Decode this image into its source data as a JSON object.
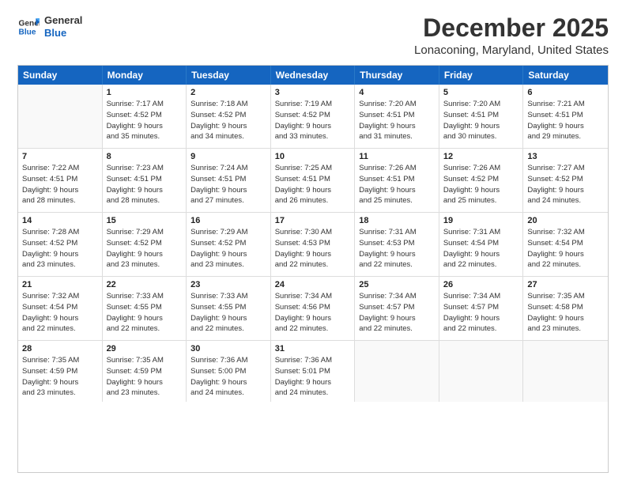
{
  "header": {
    "logo_line1": "General",
    "logo_line2": "Blue",
    "main_title": "December 2025",
    "subtitle": "Lonaconing, Maryland, United States"
  },
  "calendar": {
    "days_of_week": [
      "Sunday",
      "Monday",
      "Tuesday",
      "Wednesday",
      "Thursday",
      "Friday",
      "Saturday"
    ],
    "rows": [
      [
        {
          "day": "",
          "info": ""
        },
        {
          "day": "1",
          "info": "Sunrise: 7:17 AM\nSunset: 4:52 PM\nDaylight: 9 hours\nand 35 minutes."
        },
        {
          "day": "2",
          "info": "Sunrise: 7:18 AM\nSunset: 4:52 PM\nDaylight: 9 hours\nand 34 minutes."
        },
        {
          "day": "3",
          "info": "Sunrise: 7:19 AM\nSunset: 4:52 PM\nDaylight: 9 hours\nand 33 minutes."
        },
        {
          "day": "4",
          "info": "Sunrise: 7:20 AM\nSunset: 4:51 PM\nDaylight: 9 hours\nand 31 minutes."
        },
        {
          "day": "5",
          "info": "Sunrise: 7:20 AM\nSunset: 4:51 PM\nDaylight: 9 hours\nand 30 minutes."
        },
        {
          "day": "6",
          "info": "Sunrise: 7:21 AM\nSunset: 4:51 PM\nDaylight: 9 hours\nand 29 minutes."
        }
      ],
      [
        {
          "day": "7",
          "info": "Sunrise: 7:22 AM\nSunset: 4:51 PM\nDaylight: 9 hours\nand 28 minutes."
        },
        {
          "day": "8",
          "info": "Sunrise: 7:23 AM\nSunset: 4:51 PM\nDaylight: 9 hours\nand 28 minutes."
        },
        {
          "day": "9",
          "info": "Sunrise: 7:24 AM\nSunset: 4:51 PM\nDaylight: 9 hours\nand 27 minutes."
        },
        {
          "day": "10",
          "info": "Sunrise: 7:25 AM\nSunset: 4:51 PM\nDaylight: 9 hours\nand 26 minutes."
        },
        {
          "day": "11",
          "info": "Sunrise: 7:26 AM\nSunset: 4:51 PM\nDaylight: 9 hours\nand 25 minutes."
        },
        {
          "day": "12",
          "info": "Sunrise: 7:26 AM\nSunset: 4:52 PM\nDaylight: 9 hours\nand 25 minutes."
        },
        {
          "day": "13",
          "info": "Sunrise: 7:27 AM\nSunset: 4:52 PM\nDaylight: 9 hours\nand 24 minutes."
        }
      ],
      [
        {
          "day": "14",
          "info": "Sunrise: 7:28 AM\nSunset: 4:52 PM\nDaylight: 9 hours\nand 23 minutes."
        },
        {
          "day": "15",
          "info": "Sunrise: 7:29 AM\nSunset: 4:52 PM\nDaylight: 9 hours\nand 23 minutes."
        },
        {
          "day": "16",
          "info": "Sunrise: 7:29 AM\nSunset: 4:52 PM\nDaylight: 9 hours\nand 23 minutes."
        },
        {
          "day": "17",
          "info": "Sunrise: 7:30 AM\nSunset: 4:53 PM\nDaylight: 9 hours\nand 22 minutes."
        },
        {
          "day": "18",
          "info": "Sunrise: 7:31 AM\nSunset: 4:53 PM\nDaylight: 9 hours\nand 22 minutes."
        },
        {
          "day": "19",
          "info": "Sunrise: 7:31 AM\nSunset: 4:54 PM\nDaylight: 9 hours\nand 22 minutes."
        },
        {
          "day": "20",
          "info": "Sunrise: 7:32 AM\nSunset: 4:54 PM\nDaylight: 9 hours\nand 22 minutes."
        }
      ],
      [
        {
          "day": "21",
          "info": "Sunrise: 7:32 AM\nSunset: 4:54 PM\nDaylight: 9 hours\nand 22 minutes."
        },
        {
          "day": "22",
          "info": "Sunrise: 7:33 AM\nSunset: 4:55 PM\nDaylight: 9 hours\nand 22 minutes."
        },
        {
          "day": "23",
          "info": "Sunrise: 7:33 AM\nSunset: 4:55 PM\nDaylight: 9 hours\nand 22 minutes."
        },
        {
          "day": "24",
          "info": "Sunrise: 7:34 AM\nSunset: 4:56 PM\nDaylight: 9 hours\nand 22 minutes."
        },
        {
          "day": "25",
          "info": "Sunrise: 7:34 AM\nSunset: 4:57 PM\nDaylight: 9 hours\nand 22 minutes."
        },
        {
          "day": "26",
          "info": "Sunrise: 7:34 AM\nSunset: 4:57 PM\nDaylight: 9 hours\nand 22 minutes."
        },
        {
          "day": "27",
          "info": "Sunrise: 7:35 AM\nSunset: 4:58 PM\nDaylight: 9 hours\nand 23 minutes."
        }
      ],
      [
        {
          "day": "28",
          "info": "Sunrise: 7:35 AM\nSunset: 4:59 PM\nDaylight: 9 hours\nand 23 minutes."
        },
        {
          "day": "29",
          "info": "Sunrise: 7:35 AM\nSunset: 4:59 PM\nDaylight: 9 hours\nand 23 minutes."
        },
        {
          "day": "30",
          "info": "Sunrise: 7:36 AM\nSunset: 5:00 PM\nDaylight: 9 hours\nand 24 minutes."
        },
        {
          "day": "31",
          "info": "Sunrise: 7:36 AM\nSunset: 5:01 PM\nDaylight: 9 hours\nand 24 minutes."
        },
        {
          "day": "",
          "info": ""
        },
        {
          "day": "",
          "info": ""
        },
        {
          "day": "",
          "info": ""
        }
      ]
    ]
  }
}
